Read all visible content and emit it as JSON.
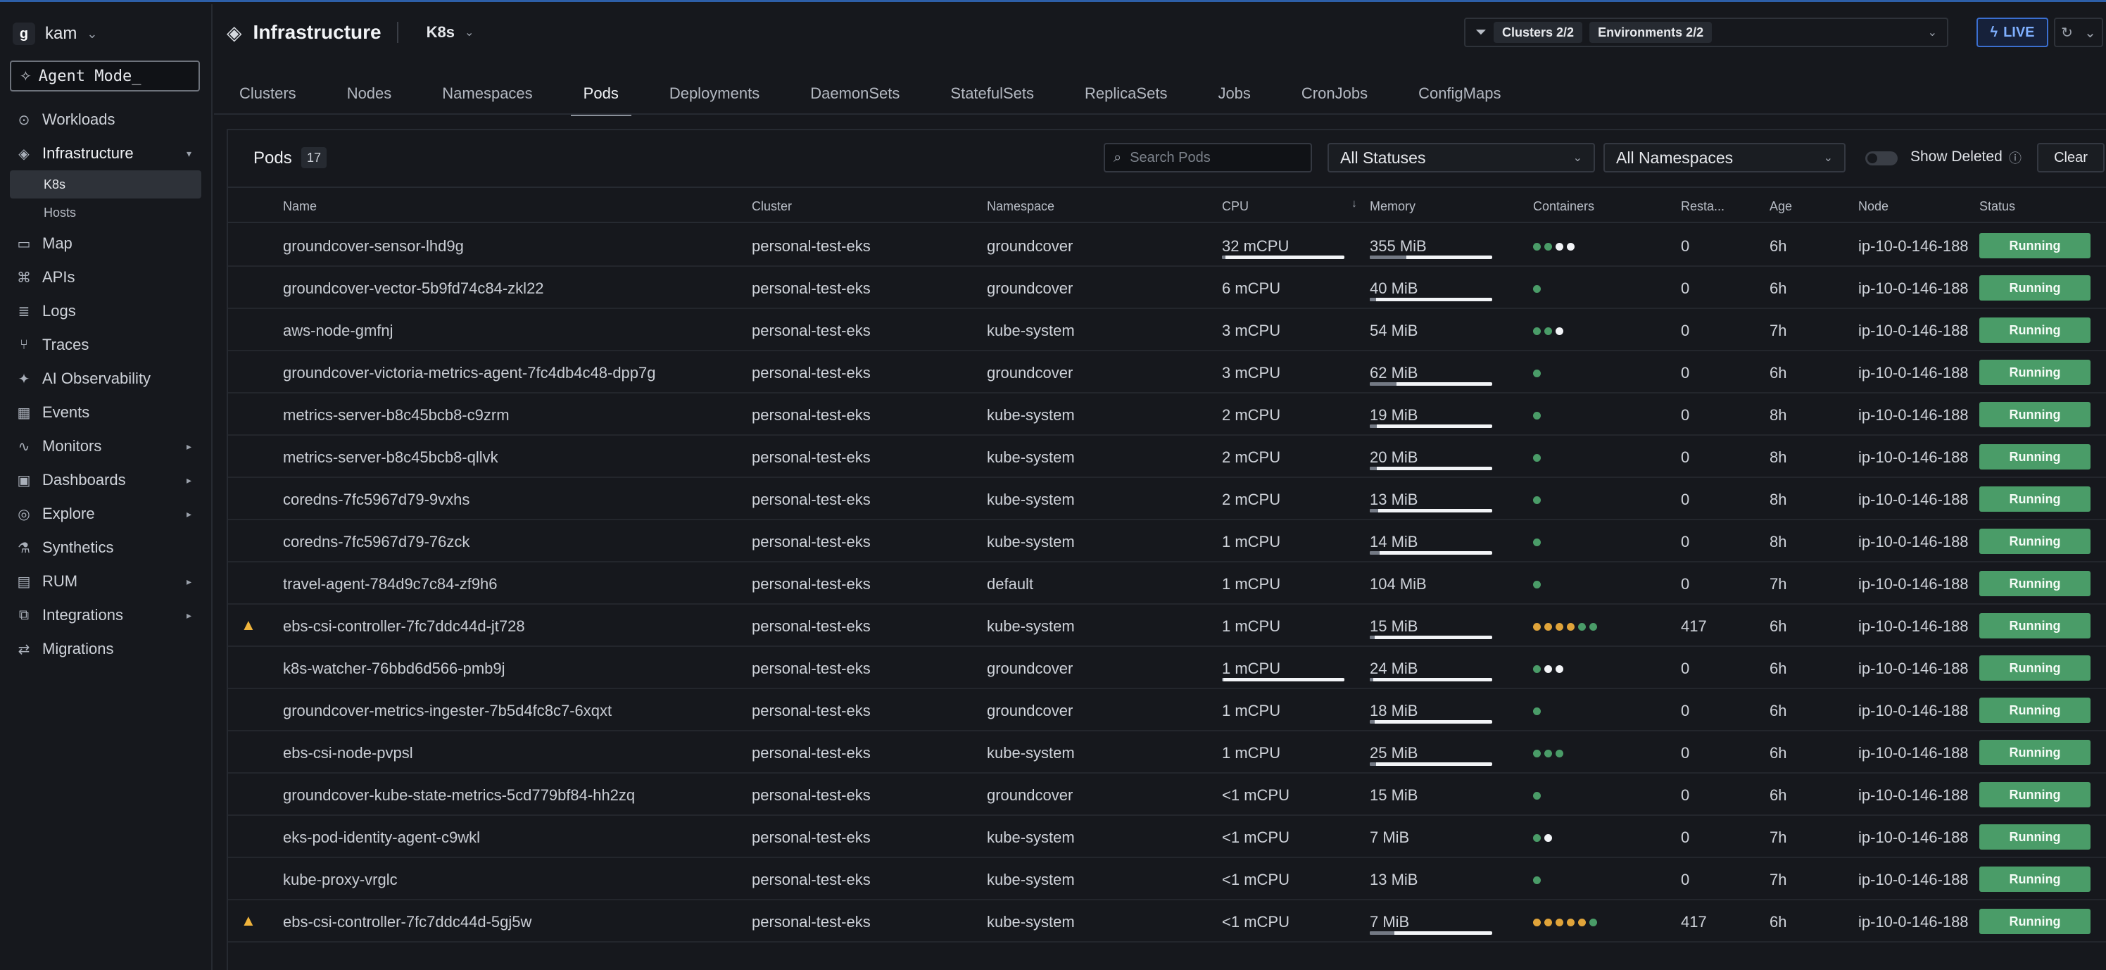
{
  "workspace": {
    "name": "kam",
    "logo_letter": "g"
  },
  "agent_mode": {
    "label": "Agent Mode_"
  },
  "sidebar": {
    "items": [
      {
        "label": "Workloads",
        "icon": "workloads-icon",
        "glyph": "⊙"
      },
      {
        "label": "Infrastructure",
        "icon": "layers-icon",
        "glyph": "◈",
        "expanded": true
      },
      {
        "label": "Map",
        "icon": "map-icon",
        "glyph": "▭"
      },
      {
        "label": "APIs",
        "icon": "api-icon",
        "glyph": "⌘"
      },
      {
        "label": "Logs",
        "icon": "logs-icon",
        "glyph": "≣"
      },
      {
        "label": "Traces",
        "icon": "traces-icon",
        "glyph": "⑂"
      },
      {
        "label": "AI Observability",
        "icon": "ai-icon",
        "glyph": "✦"
      },
      {
        "label": "Events",
        "icon": "events-icon",
        "glyph": "▦"
      },
      {
        "label": "Monitors",
        "icon": "monitors-icon",
        "glyph": "∿",
        "arrow": true
      },
      {
        "label": "Dashboards",
        "icon": "dashboards-icon",
        "glyph": "▣",
        "arrow": true
      },
      {
        "label": "Explore",
        "icon": "explore-icon",
        "glyph": "◎",
        "arrow": true
      },
      {
        "label": "Synthetics",
        "icon": "synthetics-icon",
        "glyph": "⚗"
      },
      {
        "label": "RUM",
        "icon": "rum-icon",
        "glyph": "▤",
        "arrow": true
      },
      {
        "label": "Integrations",
        "icon": "integrations-icon",
        "glyph": "⧉",
        "arrow": true
      },
      {
        "label": "Migrations",
        "icon": "migrations-icon",
        "glyph": "⇄"
      }
    ],
    "sub_items": [
      "K8s",
      "Hosts"
    ]
  },
  "header": {
    "title": "Infrastructure",
    "context": "K8s",
    "filters": {
      "clusters": "Clusters 2/2",
      "environments": "Environments 2/2"
    },
    "live_label": "LIVE"
  },
  "tabs": [
    "Clusters",
    "Nodes",
    "Namespaces",
    "Pods",
    "Deployments",
    "DaemonSets",
    "StatefulSets",
    "ReplicaSets",
    "Jobs",
    "CronJobs",
    "ConfigMaps"
  ],
  "active_tab": "Pods",
  "panel": {
    "title": "Pods",
    "count": "17",
    "search_placeholder": "Search Pods",
    "status_filter": "All Statuses",
    "namespace_filter": "All Namespaces",
    "show_deleted": "Show Deleted",
    "clear": "Clear"
  },
  "columns": [
    "Name",
    "Cluster",
    "Namespace",
    "CPU",
    "Memory",
    "Containers",
    "Resta...",
    "Age",
    "Node",
    "Status"
  ],
  "colors": {
    "status_running": "#4a9c68",
    "container_green": "#4a9c68",
    "container_white": "#f2f4f7",
    "container_orange": "#e0a43a",
    "warning": "#f0b43c",
    "live": "#7fb0ff"
  },
  "rows": [
    {
      "name": "groundcover-sensor-lhd9g",
      "cluster": "personal-test-eks",
      "namespace": "groundcover",
      "cpu": "32 mCPU",
      "cpu_fraction": 0.97,
      "memory": "355 MiB",
      "memory_fraction": 0.3,
      "containers": [
        "green",
        "green",
        "white",
        "white"
      ],
      "restarts": "0",
      "age": "6h",
      "node": "ip-10-0-146-188",
      "status": "Running"
    },
    {
      "name": "groundcover-vector-5b9fd74c84-zkl22",
      "cluster": "personal-test-eks",
      "namespace": "groundcover",
      "cpu": "6 mCPU",
      "memory": "40 MiB",
      "memory_fraction": 0.05,
      "containers": [
        "green"
      ],
      "restarts": "0",
      "age": "6h",
      "node": "ip-10-0-146-188",
      "status": "Running"
    },
    {
      "name": "aws-node-gmfnj",
      "cluster": "personal-test-eks",
      "namespace": "kube-system",
      "cpu": "3 mCPU",
      "memory": "54 MiB",
      "containers": [
        "green",
        "green",
        "white"
      ],
      "restarts": "0",
      "age": "7h",
      "node": "ip-10-0-146-188",
      "status": "Running"
    },
    {
      "name": "groundcover-victoria-metrics-agent-7fc4db4c48-dpp7g",
      "cluster": "personal-test-eks",
      "namespace": "groundcover",
      "cpu": "3 mCPU",
      "memory": "62 MiB",
      "memory_fraction": 0.22,
      "containers": [
        "green"
      ],
      "restarts": "0",
      "age": "6h",
      "node": "ip-10-0-146-188",
      "status": "Running"
    },
    {
      "name": "metrics-server-b8c45bcb8-c9zrm",
      "cluster": "personal-test-eks",
      "namespace": "kube-system",
      "cpu": "2 mCPU",
      "memory": "19 MiB",
      "memory_fraction": 0.06,
      "containers": [
        "green"
      ],
      "restarts": "0",
      "age": "8h",
      "node": "ip-10-0-146-188",
      "status": "Running"
    },
    {
      "name": "metrics-server-b8c45bcb8-qllvk",
      "cluster": "personal-test-eks",
      "namespace": "kube-system",
      "cpu": "2 mCPU",
      "memory": "20 MiB",
      "memory_fraction": 0.06,
      "containers": [
        "green"
      ],
      "restarts": "0",
      "age": "8h",
      "node": "ip-10-0-146-188",
      "status": "Running"
    },
    {
      "name": "coredns-7fc5967d79-9vxhs",
      "cluster": "personal-test-eks",
      "namespace": "kube-system",
      "cpu": "2 mCPU",
      "memory": "13 MiB",
      "memory_fraction": 0.07,
      "containers": [
        "green"
      ],
      "restarts": "0",
      "age": "8h",
      "node": "ip-10-0-146-188",
      "status": "Running"
    },
    {
      "name": "coredns-7fc5967d79-76zck",
      "cluster": "personal-test-eks",
      "namespace": "kube-system",
      "cpu": "1 mCPU",
      "memory": "14 MiB",
      "memory_fraction": 0.08,
      "containers": [
        "green"
      ],
      "restarts": "0",
      "age": "8h",
      "node": "ip-10-0-146-188",
      "status": "Running"
    },
    {
      "name": "travel-agent-784d9c7c84-zf9h6",
      "cluster": "personal-test-eks",
      "namespace": "default",
      "cpu": "1 mCPU",
      "memory": "104 MiB",
      "containers": [
        "green"
      ],
      "restarts": "0",
      "age": "7h",
      "node": "ip-10-0-146-188",
      "status": "Running"
    },
    {
      "name": "ebs-csi-controller-7fc7ddc44d-jt728",
      "warning": true,
      "cluster": "personal-test-eks",
      "namespace": "kube-system",
      "cpu": "1 mCPU",
      "memory": "15 MiB",
      "memory_fraction": 0.04,
      "containers": [
        "orange",
        "orange",
        "orange",
        "orange",
        "green",
        "green"
      ],
      "restarts": "417",
      "age": "6h",
      "node": "ip-10-0-146-188",
      "status": "Running"
    },
    {
      "name": "k8s-watcher-76bbd6d566-pmb9j",
      "cluster": "personal-test-eks",
      "namespace": "groundcover",
      "cpu": "1 mCPU",
      "cpu_fraction": 0.99,
      "memory": "24 MiB",
      "memory_fraction": 0.03,
      "containers": [
        "green",
        "white",
        "white"
      ],
      "restarts": "0",
      "age": "6h",
      "node": "ip-10-0-146-188",
      "status": "Running"
    },
    {
      "name": "groundcover-metrics-ingester-7b5d4fc8c7-6xqxt",
      "cluster": "personal-test-eks",
      "namespace": "groundcover",
      "cpu": "1 mCPU",
      "memory": "18 MiB",
      "memory_fraction": 0.04,
      "containers": [
        "green"
      ],
      "restarts": "0",
      "age": "6h",
      "node": "ip-10-0-146-188",
      "status": "Running"
    },
    {
      "name": "ebs-csi-node-pvpsl",
      "cluster": "personal-test-eks",
      "namespace": "kube-system",
      "cpu": "1 mCPU",
      "memory": "25 MiB",
      "memory_fraction": 0.05,
      "containers": [
        "green",
        "green",
        "green"
      ],
      "restarts": "0",
      "age": "6h",
      "node": "ip-10-0-146-188",
      "status": "Running"
    },
    {
      "name": "groundcover-kube-state-metrics-5cd779bf84-hh2zq",
      "cluster": "personal-test-eks",
      "namespace": "groundcover",
      "cpu": "<1 mCPU",
      "memory": "15 MiB",
      "containers": [
        "green"
      ],
      "restarts": "0",
      "age": "6h",
      "node": "ip-10-0-146-188",
      "status": "Running"
    },
    {
      "name": "eks-pod-identity-agent-c9wkl",
      "cluster": "personal-test-eks",
      "namespace": "kube-system",
      "cpu": "<1 mCPU",
      "memory": "7 MiB",
      "containers": [
        "green",
        "white"
      ],
      "restarts": "0",
      "age": "7h",
      "node": "ip-10-0-146-188",
      "status": "Running"
    },
    {
      "name": "kube-proxy-vrglc",
      "cluster": "personal-test-eks",
      "namespace": "kube-system",
      "cpu": "<1 mCPU",
      "memory": "13 MiB",
      "containers": [
        "green"
      ],
      "restarts": "0",
      "age": "7h",
      "node": "ip-10-0-146-188",
      "status": "Running"
    },
    {
      "name": "ebs-csi-controller-7fc7ddc44d-5gj5w",
      "warning": true,
      "cluster": "personal-test-eks",
      "namespace": "kube-system",
      "cpu": "<1 mCPU",
      "memory": "7 MiB",
      "memory_fraction": 0.2,
      "containers": [
        "orange",
        "orange",
        "orange",
        "orange",
        "orange",
        "green"
      ],
      "restarts": "417",
      "age": "6h",
      "node": "ip-10-0-146-188",
      "status": "Running"
    }
  ]
}
